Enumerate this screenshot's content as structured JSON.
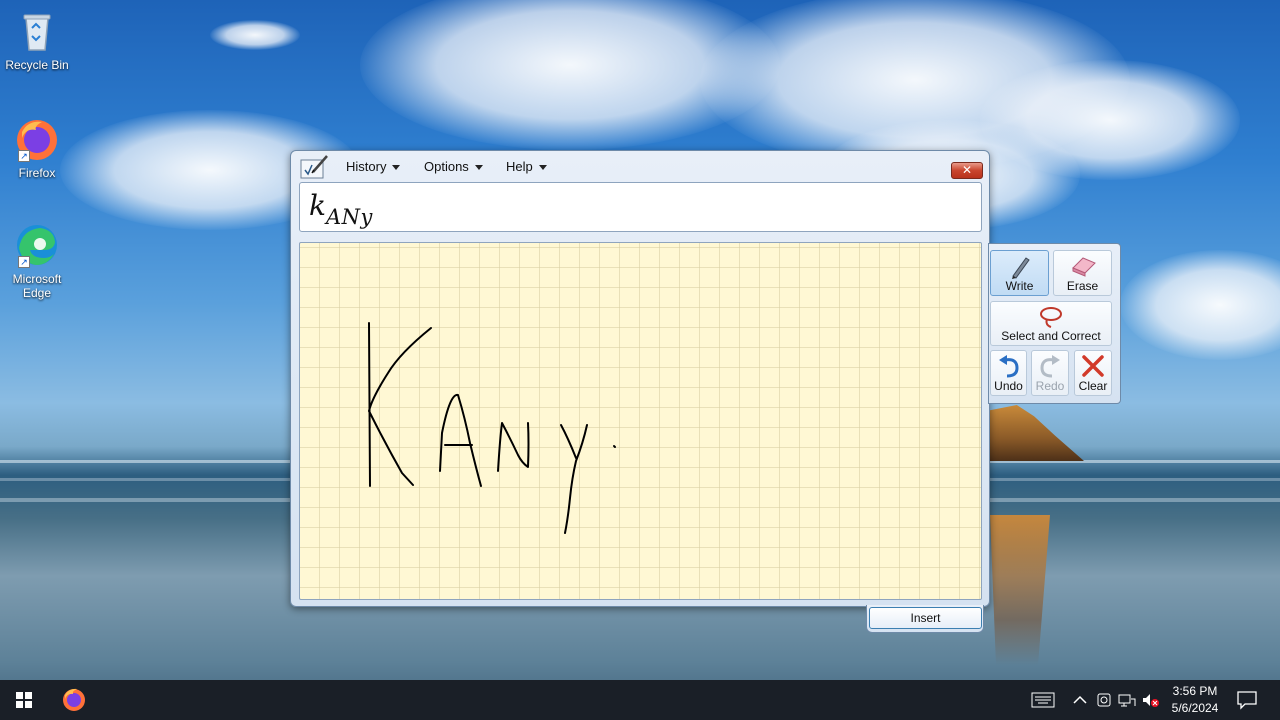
{
  "desktop": {
    "icons": [
      {
        "label": "Recycle Bin"
      },
      {
        "label": "Firefox"
      },
      {
        "label": "Microsoft Edge"
      }
    ]
  },
  "tip_window": {
    "menus": [
      "History",
      "Options",
      "Help"
    ],
    "close_glyph": "✕",
    "preview": {
      "main": "k",
      "sub": "ANy"
    },
    "insert_label": "Insert"
  },
  "tools": {
    "write": "Write",
    "erase": "Erase",
    "select_correct": "Select and Correct",
    "undo": "Undo",
    "redo": "Redo",
    "clear": "Clear",
    "redo_enabled": false
  },
  "taskbar": {
    "time": "3:56 PM",
    "date": "5/6/2024"
  },
  "colors": {
    "accent": "#3c7fb1",
    "pad": "#fff8d4",
    "taskbar": "#1a1f27"
  }
}
